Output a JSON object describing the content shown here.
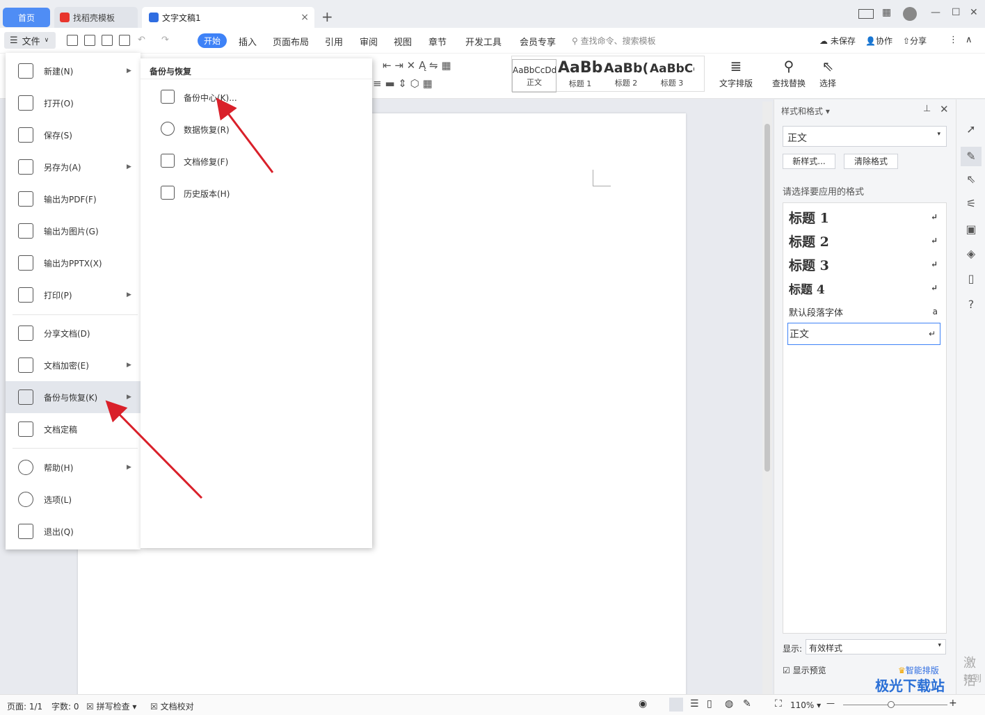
{
  "titlebar": {
    "tabs": [
      {
        "label": "首页"
      },
      {
        "label": "找稻壳模板"
      },
      {
        "label": "文字文稿1"
      }
    ],
    "add": "+",
    "close": "×"
  },
  "menubar": {
    "file": "文件",
    "items": [
      "开始",
      "插入",
      "页面布局",
      "引用",
      "审阅",
      "视图",
      "章节",
      "开发工具",
      "会员专享"
    ],
    "search": "查找命令、搜索模板",
    "unsaved": "未保存",
    "collab": "协作",
    "share": "分享"
  },
  "ribbon": {
    "styles": [
      {
        "sample": "AaBbCcDd",
        "label": "正文"
      },
      {
        "sample": "AaBb",
        "label": "标题 1"
      },
      {
        "sample": "AaBb(",
        "label": "标题 2"
      },
      {
        "sample": "AaBbCc",
        "label": "标题 3"
      }
    ],
    "layout": "文字排版",
    "find": "查找替换",
    "select": "选择"
  },
  "filemenu": {
    "items": [
      {
        "label": "新建(N)",
        "arrow": true
      },
      {
        "label": "打开(O)"
      },
      {
        "label": "保存(S)"
      },
      {
        "label": "另存为(A)",
        "arrow": true
      },
      {
        "label": "输出为PDF(F)"
      },
      {
        "label": "输出为图片(G)"
      },
      {
        "label": "输出为PPTX(X)"
      },
      {
        "label": "打印(P)",
        "arrow": true
      },
      {
        "label": "分享文档(D)"
      },
      {
        "label": "文档加密(E)",
        "arrow": true
      },
      {
        "label": "备份与恢复(K)",
        "arrow": true,
        "active": true
      },
      {
        "label": "文档定稿"
      },
      {
        "label": "帮助(H)",
        "arrow": true
      },
      {
        "label": "选项(L)"
      },
      {
        "label": "退出(Q)"
      }
    ]
  },
  "submenu": {
    "title": "备份与恢复",
    "items": [
      {
        "label": "备份中心(K)..."
      },
      {
        "label": "数据恢复(R)"
      },
      {
        "label": "文档修复(F)"
      },
      {
        "label": "历史版本(H)"
      }
    ]
  },
  "panel": {
    "title": "样式和格式",
    "current": "正文",
    "new_style": "新样式...",
    "clear": "清除格式",
    "hint": "请选择要应用的格式",
    "styles": [
      {
        "label": "标题  1",
        "bold": true
      },
      {
        "label": "标题  2",
        "bold": true
      },
      {
        "label": "标题  3",
        "bold": true
      },
      {
        "label": "标题  4",
        "bold": true
      },
      {
        "label": "默认段落字体",
        "bold": false,
        "mark": "a"
      },
      {
        "label": "正文",
        "bold": false
      }
    ],
    "show_label": "显示:",
    "show_value": "有效样式",
    "preview": "显示预览",
    "smart": "智能排版"
  },
  "status": {
    "page": "页面: 1/1",
    "words": "字数: 0",
    "spell": "拼写检查",
    "proof": "文档校对",
    "zoom": "110%"
  },
  "watermark": "极光下载站",
  "activate": "激活",
  "activate2": "转到"
}
